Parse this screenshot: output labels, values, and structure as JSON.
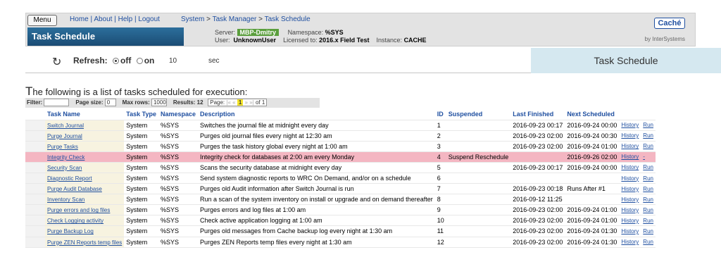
{
  "menu": {
    "label": "Menu"
  },
  "nav": {
    "home": "Home",
    "about": "About",
    "help": "Help",
    "logout": "Logout",
    "sep": "|"
  },
  "breadcrumb": {
    "system": "System",
    "task_manager": "Task Manager",
    "task_schedule": "Task Schedule",
    "arrow": ">"
  },
  "page_title": "Task Schedule",
  "server": {
    "server_label": "Server:",
    "server_value": "MBP-Dmitry",
    "namespace_label": "Namespace:",
    "namespace_value": "%SYS",
    "user_label": "User:",
    "user_value": "UnknownUser",
    "licensed_label": "Licensed to:",
    "licensed_value": "2016.x Field Test",
    "instance_label": "Instance:",
    "instance_value": "CACHE"
  },
  "brand": {
    "logo": "Caché",
    "by": "by InterSystems"
  },
  "refresh": {
    "label": "Refresh:",
    "off": "off",
    "on": "on",
    "interval": "10",
    "unit": "sec"
  },
  "right_panel_title": "Task Schedule",
  "intro": {
    "first_letter": "T",
    "rest": "he following is a list of tasks scheduled for execution:"
  },
  "filterbar": {
    "filter_label": "Filter:",
    "filter_value": "",
    "page_size_label": "Page size:",
    "page_size_value": "0",
    "max_rows_label": "Max rows:",
    "max_rows_value": "1000",
    "results_label": "Results: 12",
    "page_label": "Page:",
    "first": "|«",
    "prev": "«",
    "current": "1",
    "next": "»",
    "last": "»|",
    "of": "of 1"
  },
  "columns": [
    "Task Name",
    "Task Type",
    "Namespace",
    "Description",
    "ID",
    "Suspended",
    "Last Finished",
    "Next Scheduled"
  ],
  "rows": [
    {
      "name": "Switch Journal",
      "type": "System",
      "ns": "%SYS",
      "desc": "Switches the journal file at midnight every day",
      "id": "1",
      "suspended": "",
      "last": "2016-09-23 00:17",
      "next": "2016-09-24 00:00",
      "history": "History",
      "run": "Run"
    },
    {
      "name": "Purge Journal",
      "type": "System",
      "ns": "%SYS",
      "desc": "Purges old journal files every night at 12:30 am",
      "id": "2",
      "suspended": "",
      "last": "2016-09-23 02:00",
      "next": "2016-09-24 00:30",
      "history": "History",
      "run": "Run"
    },
    {
      "name": "Purge Tasks",
      "type": "System",
      "ns": "%SYS",
      "desc": "Purges the task history global every night at 1:00 am",
      "id": "3",
      "suspended": "",
      "last": "2016-09-23 02:00",
      "next": "2016-09-24 01:00",
      "history": "History",
      "run": "Run"
    },
    {
      "name": "Integrity Check",
      "type": "System",
      "ns": "%SYS",
      "desc": "Integrity check for databases at 2:00 am every Monday",
      "id": "4",
      "suspended": "Suspend Reschedule",
      "last": "",
      "next": "2016-09-26 02:00",
      "history": "History",
      "run": "-"
    },
    {
      "name": "Security Scan",
      "type": "System",
      "ns": "%SYS",
      "desc": "Scans the security database at midnight every day",
      "id": "5",
      "suspended": "",
      "last": "2016-09-23 00:17",
      "next": "2016-09-24 00:00",
      "history": "History",
      "run": "Run"
    },
    {
      "name": "Diagnostic Report",
      "type": "System",
      "ns": "%SYS",
      "desc": "Send system diagnostic reports to WRC On Demand, and/or on a schedule",
      "id": "6",
      "suspended": "",
      "last": "",
      "next": "",
      "history": "History",
      "run": "Run"
    },
    {
      "name": "Purge Audit Database",
      "type": "System",
      "ns": "%SYS",
      "desc": "Purges old Audit information after Switch Journal is run",
      "id": "7",
      "suspended": "",
      "last": "2016-09-23 00:18",
      "next": "Runs After #1",
      "history": "History",
      "run": "Run"
    },
    {
      "name": "Inventory Scan",
      "type": "System",
      "ns": "%SYS",
      "desc": "Run a scan of the system inventory on install or upgrade and on demand thereafter",
      "id": "8",
      "suspended": "",
      "last": "2016-09-12 11:25",
      "next": "",
      "history": "History",
      "run": "Run"
    },
    {
      "name": "Purge errors and log files",
      "type": "System",
      "ns": "%SYS",
      "desc": "Purges errors and log files at 1:00 am",
      "id": "9",
      "suspended": "",
      "last": "2016-09-23 02:00",
      "next": "2016-09-24 01:00",
      "history": "History",
      "run": "Run"
    },
    {
      "name": "Check Logging activity",
      "type": "System",
      "ns": "%SYS",
      "desc": "Check active application logging at 1:00 am",
      "id": "10",
      "suspended": "",
      "last": "2016-09-23 02:00",
      "next": "2016-09-24 01:00",
      "history": "History",
      "run": "Run"
    },
    {
      "name": "Purge Backup Log",
      "type": "System",
      "ns": "%SYS",
      "desc": "Purges old messages from Cache backup log every night at 1:30 am",
      "id": "11",
      "suspended": "",
      "last": "2016-09-23 02:00",
      "next": "2016-09-24 01:30",
      "history": "History",
      "run": "Run"
    },
    {
      "name": "Purge ZEN Reports temp files",
      "type": "System",
      "ns": "%SYS",
      "desc": "Purges ZEN Reports temp files every night at 1:30 am",
      "id": "12",
      "suspended": "",
      "last": "2016-09-23 02:00",
      "next": "2016-09-24 01:30",
      "history": "History",
      "run": "Run"
    }
  ],
  "highlight_row_index": 3
}
